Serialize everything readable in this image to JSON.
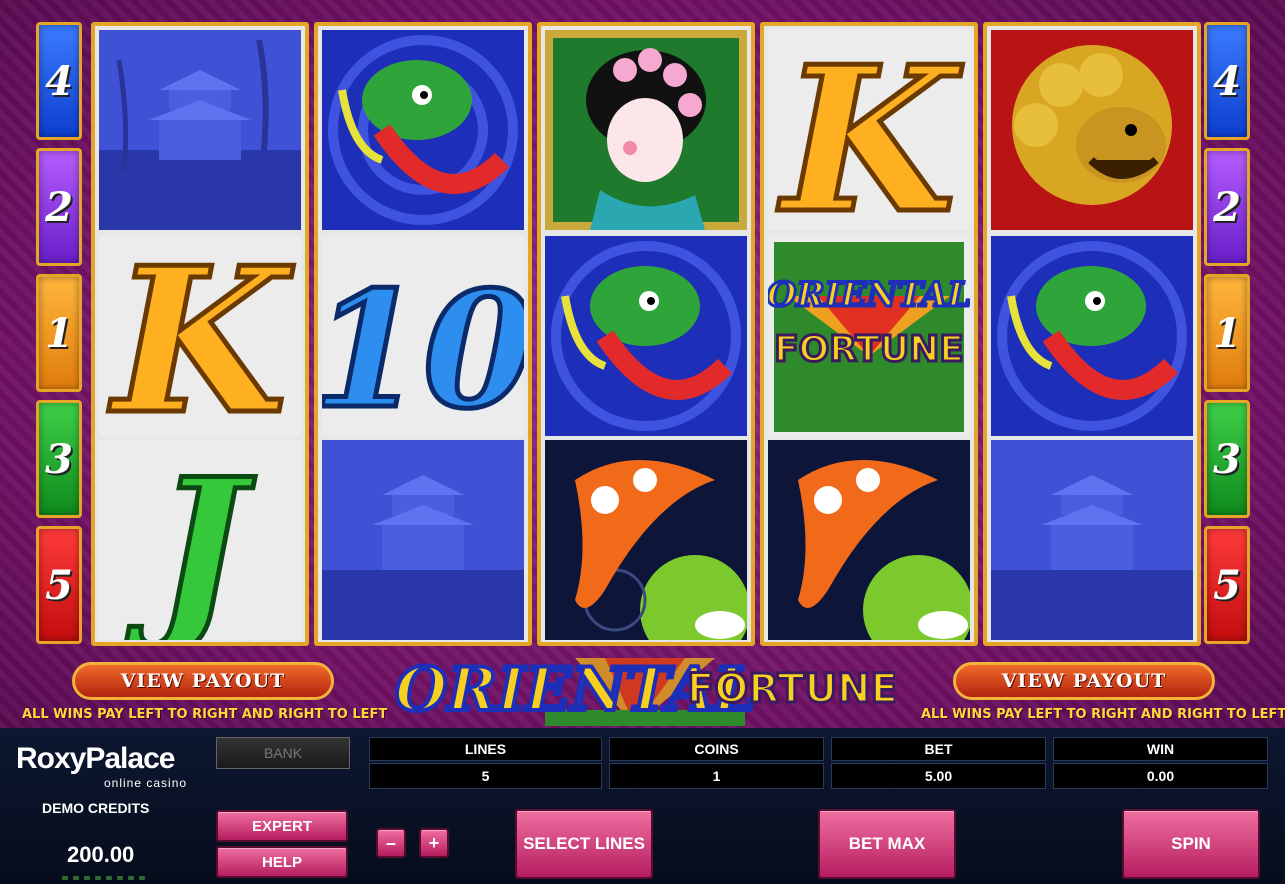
{
  "game": {
    "title_part1": "ORIENTAL",
    "title_part2": "FORTUNE",
    "line_badges_left": [
      "4",
      "2",
      "1",
      "3",
      "5"
    ],
    "line_badges_right": [
      "4",
      "2",
      "1",
      "3",
      "5"
    ],
    "reels": [
      [
        "pagoda",
        "king",
        "jack"
      ],
      [
        "dragon",
        "ten",
        "pagoda"
      ],
      [
        "geisha",
        "dragon",
        "koi"
      ],
      [
        "king",
        "oriental-fortune-logo",
        "koi"
      ],
      [
        "lion-statue",
        "dragon",
        "pagoda"
      ]
    ],
    "symbol_text": {
      "king": "K",
      "ten": "10",
      "jack": "J",
      "logo_top": "ORIENTAL",
      "logo_bottom": "FORTUNE"
    },
    "view_payout_label": "VIEW PAYOUT",
    "payout_note": "ALL WINS PAY LEFT TO RIGHT AND RIGHT TO LEFT"
  },
  "brand": {
    "name": "RoxyPalace",
    "sub": "online casino"
  },
  "credits": {
    "label": "DEMO CREDITS",
    "value": "200.00"
  },
  "buttons": {
    "bank": "BANK",
    "expert": "EXPERT",
    "help": "HELP",
    "minus": "–",
    "plus": "+",
    "select_lines": "SELECT LINES",
    "bet_max": "BET MAX",
    "spin": "SPIN"
  },
  "stats": [
    {
      "label": "LINES",
      "value": "5"
    },
    {
      "label": "COINS",
      "value": "1"
    },
    {
      "label": "BET",
      "value": "5.00"
    },
    {
      "label": "WIN",
      "value": "0.00"
    }
  ],
  "colors": {
    "background": "#7a1a6e",
    "reel_frame": "#e5a628",
    "panel": "#0c1730",
    "button_pink": "#d63c7d"
  }
}
